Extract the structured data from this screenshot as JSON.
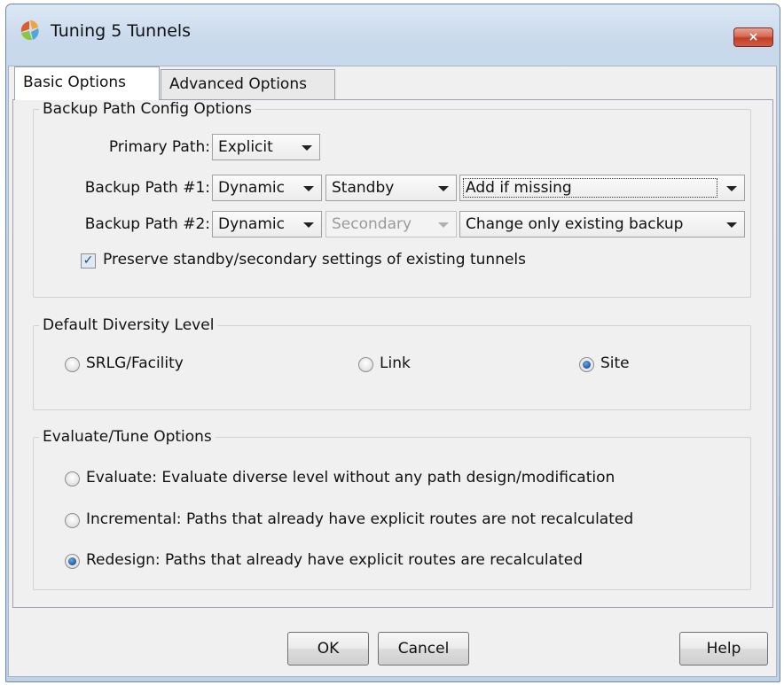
{
  "window": {
    "title": "Tuning 5 Tunnels",
    "close_label": "×"
  },
  "tabs": [
    {
      "label": "Basic Options",
      "active": true
    },
    {
      "label": "Advanced Options",
      "active": false
    }
  ],
  "backup_path_config": {
    "legend": "Backup Path Config Options",
    "primary_path": {
      "label": "Primary Path:",
      "value": "Explicit"
    },
    "backup_path_1": {
      "label": "Backup Path #1:",
      "type": "Dynamic",
      "mode": "Standby",
      "action": "Add if missing"
    },
    "backup_path_2": {
      "label": "Backup Path #2:",
      "type": "Dynamic",
      "mode": "Secondary",
      "action": "Change only existing backup"
    },
    "preserve_checkbox": {
      "label": "Preserve standby/secondary settings of existing tunnels",
      "checked": true,
      "check_glyph": "✓"
    }
  },
  "diversity": {
    "legend": "Default Diversity Level",
    "options": [
      {
        "label": "SRLG/Facility",
        "checked": false
      },
      {
        "label": "Link",
        "checked": false
      },
      {
        "label": "Site",
        "checked": true
      }
    ]
  },
  "evaluate_tune": {
    "legend": "Evaluate/Tune Options",
    "options": [
      {
        "label": "Evaluate: Evaluate diverse level without any path design/modification",
        "checked": false
      },
      {
        "label": "Incremental: Paths that already have explicit routes are not recalculated",
        "checked": false
      },
      {
        "label": "Redesign: Paths that already have explicit routes are recalculated",
        "checked": true
      }
    ]
  },
  "buttons": {
    "ok": "OK",
    "cancel": "Cancel",
    "help": "Help"
  },
  "colors": {
    "title_bar": "#c9d9ec",
    "close_button": "#c2402a",
    "dialog_bg": "#f0f0f0",
    "radio_selected": "#1c58a8"
  },
  "icons": {
    "app": "app-logo-icon",
    "close": "close-icon",
    "dropdown": "chevron-down-icon"
  }
}
